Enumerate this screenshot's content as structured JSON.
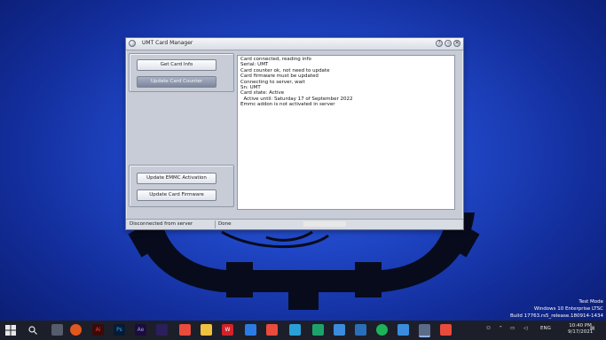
{
  "window": {
    "title": "UMT Card Manager",
    "controls": [
      "?",
      "–",
      "✕"
    ]
  },
  "buttons": {
    "get_info": "Get Card Info",
    "update_counter": "Update Card Counter",
    "update_emmc": "Update EMMC Activation",
    "update_firmware": "Update Card Firmware"
  },
  "log": [
    "Card connected, reading info",
    "Serial: UMT",
    "Card counter ok, not need to update",
    "Card firmware must be updated",
    "Connecting to server, wait",
    "Sn: UMT",
    "Card state: Active",
    "  Active until: Saturday 17 of September 2022",
    "Emmc addon is not activated in server"
  ],
  "status": {
    "connection": "Disconnected from server",
    "state": "Done"
  },
  "watermark": {
    "line1": "Test Mode",
    "line2": "Windows 10 Enterprise LTSC",
    "line3": "Build 17763.rs5_release.180914-1434"
  },
  "taskbar": {
    "tray_lang": "ENG",
    "clock_time": "10:40 PM",
    "clock_date": "9/17/2021"
  },
  "colors": {
    "desktop_blue": "#1f45c4",
    "window_bg": "#c7ccd6",
    "active_button": "#8d96ab",
    "taskbar": "#1c1f2a"
  }
}
